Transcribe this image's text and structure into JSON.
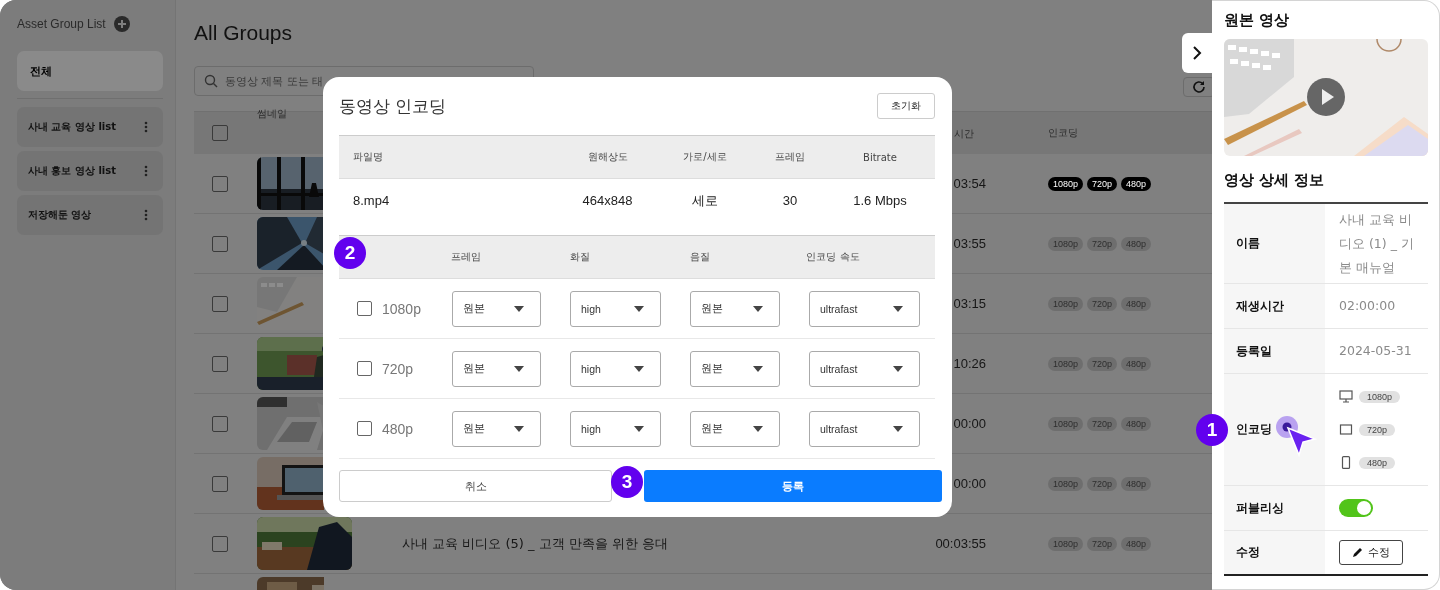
{
  "sidebar": {
    "title": "Asset Group List",
    "all": {
      "label": "전체",
      "selected": true
    },
    "groups": [
      {
        "label": "사내 교육 영상 list",
        "selected": false
      },
      {
        "label": "사내 홍보 영상 list",
        "selected": false
      },
      {
        "label": "저장해둔 영상",
        "selected": false
      }
    ]
  },
  "main": {
    "title": "All Groups",
    "search": {
      "placeholder": "동영상 제목 또는 태"
    },
    "table": {
      "columns": [
        "썸네일",
        "시간",
        "인코딩"
      ],
      "all_checked": false,
      "rows": [
        {
          "checked": false,
          "thumbnail": {
            "kind": "picture"
          },
          "duration": "03:54",
          "highlighted": true,
          "badges": [
            "1080p",
            "720p",
            "480p"
          ]
        },
        {
          "checked": false,
          "thumbnail": {
            "kind": "picture"
          },
          "duration": "03:55",
          "highlighted": false,
          "badges": [
            "1080p",
            "720p",
            "480p"
          ]
        },
        {
          "checked": false,
          "thumbnail": {
            "kind": "picture"
          },
          "duration": "03:15",
          "highlighted": false,
          "badges": [
            "1080p",
            "720p",
            "480p"
          ]
        },
        {
          "checked": false,
          "thumbnail": {
            "kind": "picture"
          },
          "duration": "10:26",
          "highlighted": false,
          "badges": [
            "1080p",
            "720p",
            "480p"
          ]
        },
        {
          "checked": false,
          "thumbnail": {
            "kind": "picture"
          },
          "duration": "00:00",
          "highlighted": false,
          "badges": [
            "1080p",
            "720p",
            "480p"
          ]
        },
        {
          "checked": false,
          "thumbnail": {
            "kind": "picture"
          },
          "duration": "00:00",
          "highlighted": false,
          "badges": [
            "1080p",
            "720p",
            "480p"
          ]
        },
        {
          "checked": false,
          "thumbnail": {
            "kind": "picture"
          },
          "title": "사내 교육 비디오 (5) _ 고객 만족을 위한 응대",
          "duration": "00:03:55",
          "highlighted": false,
          "badges": [
            "1080p",
            "720p",
            "480p"
          ]
        },
        {
          "thumbnail": {
            "kind": "picture"
          }
        }
      ]
    }
  },
  "modal": {
    "title": "동영상 인코딩",
    "reset_button": "초기화",
    "source_table": {
      "columns": [
        "파일명",
        "원해상도",
        "가로/세로",
        "프레임",
        "Bitrate"
      ],
      "row": [
        "8.mp4",
        "464x848",
        "세로",
        "30",
        "1.6 Mbps"
      ]
    },
    "encode_table": {
      "columns": [
        "프레임",
        "화질",
        "음질",
        "인코딩 속도"
      ],
      "rows": [
        {
          "label": "1080p",
          "checked": false,
          "frame": "원본",
          "quality": "high",
          "audio": "원본",
          "speed": "ultrafast"
        },
        {
          "label": "720p",
          "checked": false,
          "frame": "원본",
          "quality": "high",
          "audio": "원본",
          "speed": "ultrafast"
        },
        {
          "label": "480p",
          "checked": false,
          "frame": "원본",
          "quality": "high",
          "audio": "원본",
          "speed": "ultrafast"
        }
      ]
    },
    "cancel_button": "취소",
    "submit_button": "등록"
  },
  "panel": {
    "source_title": "원본 영상",
    "detail_title": "영상 상세 정보",
    "details": [
      {
        "kind": "text",
        "label": "이름",
        "value": "사내 교육 비디오 (1) _ 기본 매뉴얼"
      },
      {
        "kind": "text",
        "label": "재생시간",
        "value": "02:00:00"
      },
      {
        "kind": "text",
        "label": "등록일",
        "value": "2024-05-31"
      },
      {
        "kind": "encoding",
        "label": "인코딩",
        "badges": [
          "1080p",
          "720p",
          "480p"
        ]
      },
      {
        "kind": "toggle",
        "label": "퍼블리싱",
        "on": true
      },
      {
        "kind": "button",
        "label": "수정",
        "button": "수정"
      }
    ]
  },
  "annotations": [
    {
      "label": "1"
    },
    {
      "label": "2"
    },
    {
      "label": "3"
    }
  ]
}
